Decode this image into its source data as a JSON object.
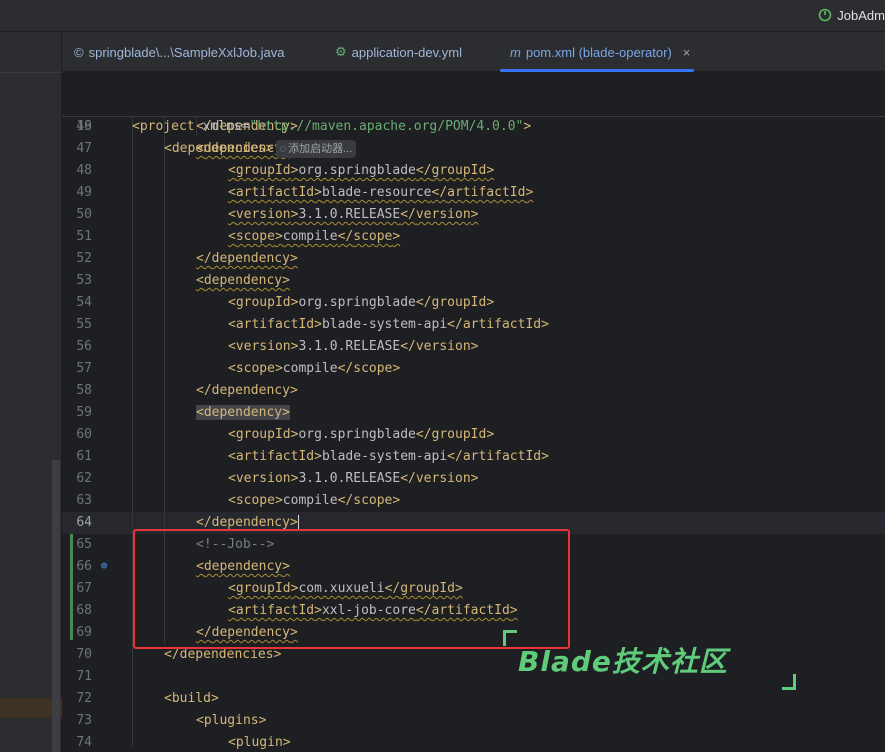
{
  "window": {
    "run_config_label": "JobAdm"
  },
  "tabs": [
    {
      "icon": "java-class-icon",
      "glyph": "©",
      "label": "springblade\\...\\SampleXxlJob.java",
      "active": false
    },
    {
      "icon": "spring-yaml-icon",
      "glyph": "⚙",
      "label": "application-dev.yml",
      "active": false
    },
    {
      "icon": "maven-icon",
      "glyph": "m",
      "label": "pom.xml (blade-operator)",
      "active": true,
      "close": "×"
    }
  ],
  "sticky": [
    {
      "num": "2",
      "project_tag": "project",
      "xmlns_attr": "xmlns",
      "xmlns_val": "\"http://maven.apache.org/POM/4.0.0\""
    },
    {
      "num": "19",
      "tag": "dependencies",
      "inlay_label": "添加启动器..."
    }
  ],
  "lines": [
    {
      "num": "46",
      "indent": 2,
      "kind": "close",
      "tag": "dependency"
    },
    {
      "num": "47",
      "indent": 2,
      "kind": "open",
      "tag": "dependency"
    },
    {
      "num": "48",
      "indent": 3,
      "kind": "elem",
      "tag": "groupId",
      "text": "org.springblade"
    },
    {
      "num": "49",
      "indent": 3,
      "kind": "elem",
      "tag": "artifactId",
      "text": "blade-resource"
    },
    {
      "num": "50",
      "indent": 3,
      "kind": "elem",
      "tag": "version",
      "text": "3.1.0.RELEASE"
    },
    {
      "num": "51",
      "indent": 3,
      "kind": "elem",
      "tag": "scope",
      "text": "compile"
    },
    {
      "num": "52",
      "indent": 2,
      "kind": "close",
      "tag": "dependency"
    },
    {
      "num": "53",
      "indent": 2,
      "kind": "open",
      "tag": "dependency"
    },
    {
      "num": "54",
      "indent": 3,
      "kind": "elem",
      "tag": "groupId",
      "text": "org.springblade"
    },
    {
      "num": "55",
      "indent": 3,
      "kind": "elem",
      "tag": "artifactId",
      "text": "blade-system-api"
    },
    {
      "num": "56",
      "indent": 3,
      "kind": "elem",
      "tag": "version",
      "text": "3.1.0.RELEASE"
    },
    {
      "num": "57",
      "indent": 3,
      "kind": "elem",
      "tag": "scope",
      "text": "compile"
    },
    {
      "num": "58",
      "indent": 2,
      "kind": "close",
      "tag": "dependency"
    },
    {
      "num": "59",
      "indent": 2,
      "kind": "open",
      "tag": "dependency"
    },
    {
      "num": "60",
      "indent": 3,
      "kind": "elem",
      "tag": "groupId",
      "text": "org.springblade"
    },
    {
      "num": "61",
      "indent": 3,
      "kind": "elem",
      "tag": "artifactId",
      "text": "blade-system-api"
    },
    {
      "num": "62",
      "indent": 3,
      "kind": "elem",
      "tag": "version",
      "text": "3.1.0.RELEASE"
    },
    {
      "num": "63",
      "indent": 3,
      "kind": "elem",
      "tag": "scope",
      "text": "compile"
    },
    {
      "num": "64",
      "indent": 2,
      "kind": "close",
      "tag": "dependency"
    },
    {
      "num": "65",
      "indent": 2,
      "kind": "comment",
      "text": "<!--Job-->"
    },
    {
      "num": "66",
      "indent": 2,
      "kind": "open",
      "tag": "dependency"
    },
    {
      "num": "67",
      "indent": 3,
      "kind": "elem",
      "tag": "groupId",
      "text": "com.xuxueli"
    },
    {
      "num": "68",
      "indent": 3,
      "kind": "elem",
      "tag": "artifactId",
      "text": "xxl-job-core"
    },
    {
      "num": "69",
      "indent": 2,
      "kind": "close",
      "tag": "dependency"
    },
    {
      "num": "70",
      "indent": 1,
      "kind": "close",
      "tag": "dependencies"
    },
    {
      "num": "71",
      "indent": 0,
      "kind": "blank"
    },
    {
      "num": "72",
      "indent": 1,
      "kind": "open",
      "tag": "build"
    },
    {
      "num": "73",
      "indent": 2,
      "kind": "open",
      "tag": "plugins"
    },
    {
      "num": "74",
      "indent": 3,
      "kind": "open",
      "tag": "plugin"
    }
  ],
  "watermark": {
    "text": "Blade技术社区"
  },
  "colors": {
    "accent": "#3574f0",
    "tag": "#d5b778",
    "string": "#6aab73",
    "comment": "#7a7e85",
    "annotation_box": "#e5343a",
    "watermark": "#5fcc7c"
  }
}
